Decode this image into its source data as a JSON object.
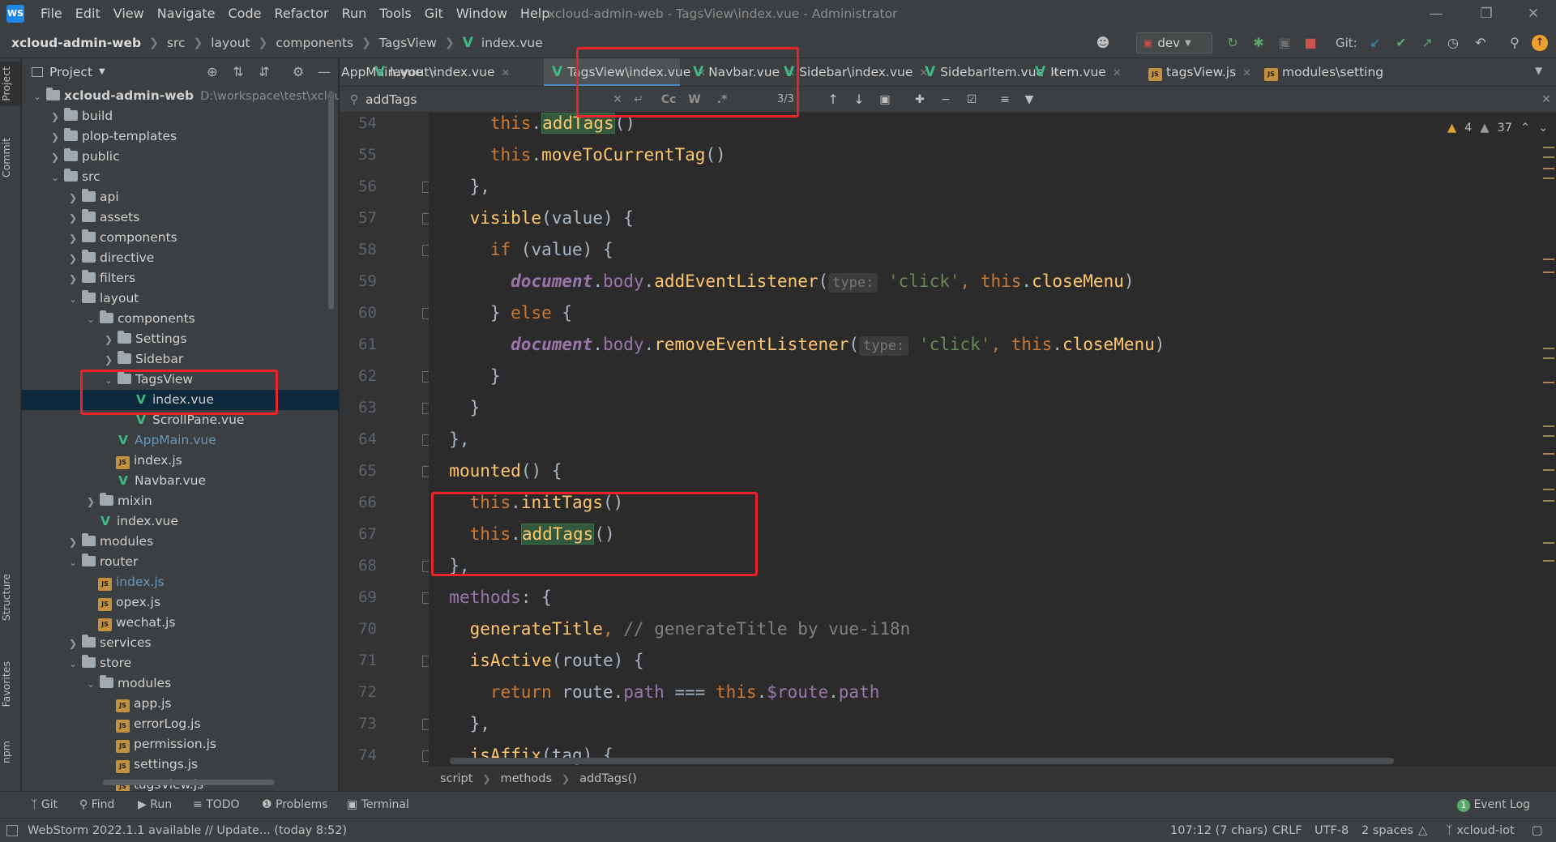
{
  "titlebar": {
    "logo": "WS",
    "menu": [
      "File",
      "Edit",
      "View",
      "Navigate",
      "Code",
      "Refactor",
      "Run",
      "Tools",
      "Git",
      "Window",
      "Help"
    ],
    "window_title": "xcloud-admin-web - TagsView\\index.vue - Administrator"
  },
  "navbar": {
    "breadcrumb": [
      "xcloud-admin-web",
      "src",
      "layout",
      "components",
      "TagsView",
      "index.vue"
    ],
    "run_config": "dev",
    "git_label": "Git:"
  },
  "left_strip": {
    "tabs": [
      "Project",
      "Commit",
      "Structure",
      "Favorites",
      "npm"
    ]
  },
  "project": {
    "title": "Project",
    "tree": [
      {
        "label": "xcloud-admin-web",
        "depth": 0,
        "kind": "root",
        "open": true,
        "hint": "D:\\workspace\\test\\xcloud"
      },
      {
        "label": "build",
        "depth": 1,
        "kind": "folder",
        "open": false
      },
      {
        "label": "plop-templates",
        "depth": 1,
        "kind": "folder",
        "open": false
      },
      {
        "label": "public",
        "depth": 1,
        "kind": "folder",
        "open": false
      },
      {
        "label": "src",
        "depth": 1,
        "kind": "folder",
        "open": true
      },
      {
        "label": "api",
        "depth": 2,
        "kind": "folder",
        "open": false
      },
      {
        "label": "assets",
        "depth": 2,
        "kind": "folder",
        "open": false
      },
      {
        "label": "components",
        "depth": 2,
        "kind": "folder",
        "open": false
      },
      {
        "label": "directive",
        "depth": 2,
        "kind": "folder",
        "open": false
      },
      {
        "label": "filters",
        "depth": 2,
        "kind": "folder",
        "open": false
      },
      {
        "label": "layout",
        "depth": 2,
        "kind": "folder",
        "open": true
      },
      {
        "label": "components",
        "depth": 3,
        "kind": "folder",
        "open": true
      },
      {
        "label": "Settings",
        "depth": 4,
        "kind": "folder",
        "open": false
      },
      {
        "label": "Sidebar",
        "depth": 4,
        "kind": "folder",
        "open": false
      },
      {
        "label": "TagsView",
        "depth": 4,
        "kind": "folder",
        "open": true
      },
      {
        "label": "index.vue",
        "depth": 5,
        "kind": "vue",
        "selected": true
      },
      {
        "label": "ScrollPane.vue",
        "depth": 5,
        "kind": "vue"
      },
      {
        "label": "AppMain.vue",
        "depth": 4,
        "kind": "vue",
        "blue": true
      },
      {
        "label": "index.js",
        "depth": 4,
        "kind": "js"
      },
      {
        "label": "Navbar.vue",
        "depth": 4,
        "kind": "vue"
      },
      {
        "label": "mixin",
        "depth": 3,
        "kind": "folder",
        "open": false
      },
      {
        "label": "index.vue",
        "depth": 3,
        "kind": "vue"
      },
      {
        "label": "modules",
        "depth": 2,
        "kind": "folder",
        "open": false
      },
      {
        "label": "router",
        "depth": 2,
        "kind": "folder",
        "open": true
      },
      {
        "label": "index.js",
        "depth": 3,
        "kind": "js",
        "blue": true
      },
      {
        "label": "opex.js",
        "depth": 3,
        "kind": "js"
      },
      {
        "label": "wechat.js",
        "depth": 3,
        "kind": "js"
      },
      {
        "label": "services",
        "depth": 2,
        "kind": "folder",
        "open": false
      },
      {
        "label": "store",
        "depth": 2,
        "kind": "folder",
        "open": true
      },
      {
        "label": "modules",
        "depth": 3,
        "kind": "folder",
        "open": true
      },
      {
        "label": "app.js",
        "depth": 4,
        "kind": "js"
      },
      {
        "label": "errorLog.js",
        "depth": 4,
        "kind": "js"
      },
      {
        "label": "permission.js",
        "depth": 4,
        "kind": "js"
      },
      {
        "label": "settings.js",
        "depth": 4,
        "kind": "js"
      },
      {
        "label": "tagsView.js",
        "depth": 4,
        "kind": "js"
      }
    ]
  },
  "tabs": [
    {
      "label": "AppMain.vue",
      "icon": "vue",
      "active": false
    },
    {
      "label": "layout\\index.vue",
      "icon": "vue",
      "active": false
    },
    {
      "label": "TagsView\\index.vue",
      "icon": "vue",
      "active": true
    },
    {
      "label": "Navbar.vue",
      "icon": "vue",
      "active": false
    },
    {
      "label": "Sidebar\\index.vue",
      "icon": "vue",
      "active": false
    },
    {
      "label": "SidebarItem.vue",
      "icon": "vue",
      "active": false
    },
    {
      "label": "Item.vue",
      "icon": "vue",
      "active": false
    },
    {
      "label": "tagsView.js",
      "icon": "js",
      "active": false
    },
    {
      "label": "modules\\setting",
      "icon": "js",
      "active": false
    }
  ],
  "find": {
    "query": "addTags",
    "match_case": "Cc",
    "words": "W",
    "regex": ".*",
    "count": "3/3"
  },
  "inspections": {
    "warnings": "4",
    "weak_warnings": "37"
  },
  "code": [
    {
      "n": "54",
      "tokens": [
        [
          "plain",
          "      "
        ],
        [
          "kw",
          "this"
        ],
        [
          "plain",
          "."
        ],
        [
          "fnhl",
          "addTags"
        ],
        [
          "plain",
          "()"
        ]
      ]
    },
    {
      "n": "55",
      "tokens": [
        [
          "plain",
          "      "
        ],
        [
          "kw",
          "this"
        ],
        [
          "plain",
          "."
        ],
        [
          "fn",
          "moveToCurrentTag"
        ],
        [
          "plain",
          "()"
        ]
      ]
    },
    {
      "n": "56",
      "tokens": [
        [
          "plain",
          "    },"
        ]
      ]
    },
    {
      "n": "57",
      "tokens": [
        [
          "plain",
          "    "
        ],
        [
          "fn",
          "visible"
        ],
        [
          "plain",
          "(value) {"
        ]
      ]
    },
    {
      "n": "58",
      "tokens": [
        [
          "plain",
          "      "
        ],
        [
          "kw",
          "if"
        ],
        [
          "plain",
          " (value) {"
        ]
      ]
    },
    {
      "n": "59",
      "tokens": [
        [
          "plain",
          "        "
        ],
        [
          "glob",
          "document"
        ],
        [
          "plain",
          "."
        ],
        [
          "prop",
          "body"
        ],
        [
          "plain",
          "."
        ],
        [
          "fn",
          "addEventListener"
        ],
        [
          "plain",
          "("
        ],
        [
          "hint",
          "type:"
        ],
        [
          "plain",
          " "
        ],
        [
          "str",
          "'click'"
        ],
        [
          "kw",
          ","
        ],
        [
          "plain",
          " "
        ],
        [
          "kw",
          "this"
        ],
        [
          "plain",
          "."
        ],
        [
          "fn",
          "closeMenu"
        ],
        [
          "plain",
          ")"
        ]
      ]
    },
    {
      "n": "60",
      "tokens": [
        [
          "plain",
          "      } "
        ],
        [
          "kw",
          "else"
        ],
        [
          "plain",
          " {"
        ]
      ]
    },
    {
      "n": "61",
      "tokens": [
        [
          "plain",
          "        "
        ],
        [
          "glob",
          "document"
        ],
        [
          "plain",
          "."
        ],
        [
          "prop",
          "body"
        ],
        [
          "plain",
          "."
        ],
        [
          "fn",
          "removeEventListener"
        ],
        [
          "plain",
          "("
        ],
        [
          "hint",
          "type:"
        ],
        [
          "plain",
          " "
        ],
        [
          "str",
          "'click'"
        ],
        [
          "kw",
          ","
        ],
        [
          "plain",
          " "
        ],
        [
          "kw",
          "this"
        ],
        [
          "plain",
          "."
        ],
        [
          "fn",
          "closeMenu"
        ],
        [
          "plain",
          ")"
        ]
      ]
    },
    {
      "n": "62",
      "tokens": [
        [
          "plain",
          "      }"
        ]
      ]
    },
    {
      "n": "63",
      "tokens": [
        [
          "plain",
          "    }"
        ]
      ]
    },
    {
      "n": "64",
      "tokens": [
        [
          "plain",
          "  },"
        ]
      ]
    },
    {
      "n": "65",
      "tokens": [
        [
          "plain",
          "  "
        ],
        [
          "fn",
          "mounted"
        ],
        [
          "plain",
          "() {"
        ]
      ]
    },
    {
      "n": "66",
      "tokens": [
        [
          "plain",
          "    "
        ],
        [
          "kw",
          "this"
        ],
        [
          "plain",
          "."
        ],
        [
          "fn",
          "initTags"
        ],
        [
          "plain",
          "()"
        ]
      ]
    },
    {
      "n": "67",
      "tokens": [
        [
          "plain",
          "    "
        ],
        [
          "kw",
          "this"
        ],
        [
          "plain",
          "."
        ],
        [
          "fnhl",
          "addTags"
        ],
        [
          "plain",
          "()"
        ]
      ]
    },
    {
      "n": "68",
      "tokens": [
        [
          "plain",
          "  },"
        ]
      ]
    },
    {
      "n": "69",
      "tokens": [
        [
          "plain",
          "  "
        ],
        [
          "prop",
          "methods"
        ],
        [
          "plain",
          ": {"
        ]
      ]
    },
    {
      "n": "70",
      "tokens": [
        [
          "plain",
          "    "
        ],
        [
          "fn",
          "generateTitle"
        ],
        [
          "kw",
          ","
        ],
        [
          "plain",
          " "
        ],
        [
          "cmt",
          "// generateTitle by vue-i18n"
        ]
      ]
    },
    {
      "n": "71",
      "tokens": [
        [
          "plain",
          "    "
        ],
        [
          "fn",
          "isActive"
        ],
        [
          "plain",
          "(route) {"
        ]
      ]
    },
    {
      "n": "72",
      "tokens": [
        [
          "plain",
          "      "
        ],
        [
          "kw",
          "return"
        ],
        [
          "plain",
          " route."
        ],
        [
          "prop",
          "path"
        ],
        [
          "plain",
          " === "
        ],
        [
          "kw",
          "this"
        ],
        [
          "plain",
          "."
        ],
        [
          "prop",
          "$route"
        ],
        [
          "plain",
          "."
        ],
        [
          "prop",
          "path"
        ]
      ]
    },
    {
      "n": "73",
      "tokens": [
        [
          "plain",
          "    },"
        ]
      ]
    },
    {
      "n": "74",
      "tokens": [
        [
          "plain",
          "    "
        ],
        [
          "fn",
          "isAffix"
        ],
        [
          "plain",
          "(tag) {"
        ]
      ]
    }
  ],
  "editor_breadcrumb": [
    "script",
    "methods",
    "addTags()"
  ],
  "bottom_tools": [
    "Git",
    "Find",
    "Run",
    "TODO",
    "Problems",
    "Terminal"
  ],
  "event_log": {
    "count": "1",
    "label": "Event Log"
  },
  "status": {
    "message": "WebStorm 2022.1.1 available // Update... (today 8:52)",
    "position": "107:12 (7 chars)",
    "line_sep": "CRLF",
    "encoding": "UTF-8",
    "indent": "2 spaces",
    "branch": "xcloud-iot"
  }
}
